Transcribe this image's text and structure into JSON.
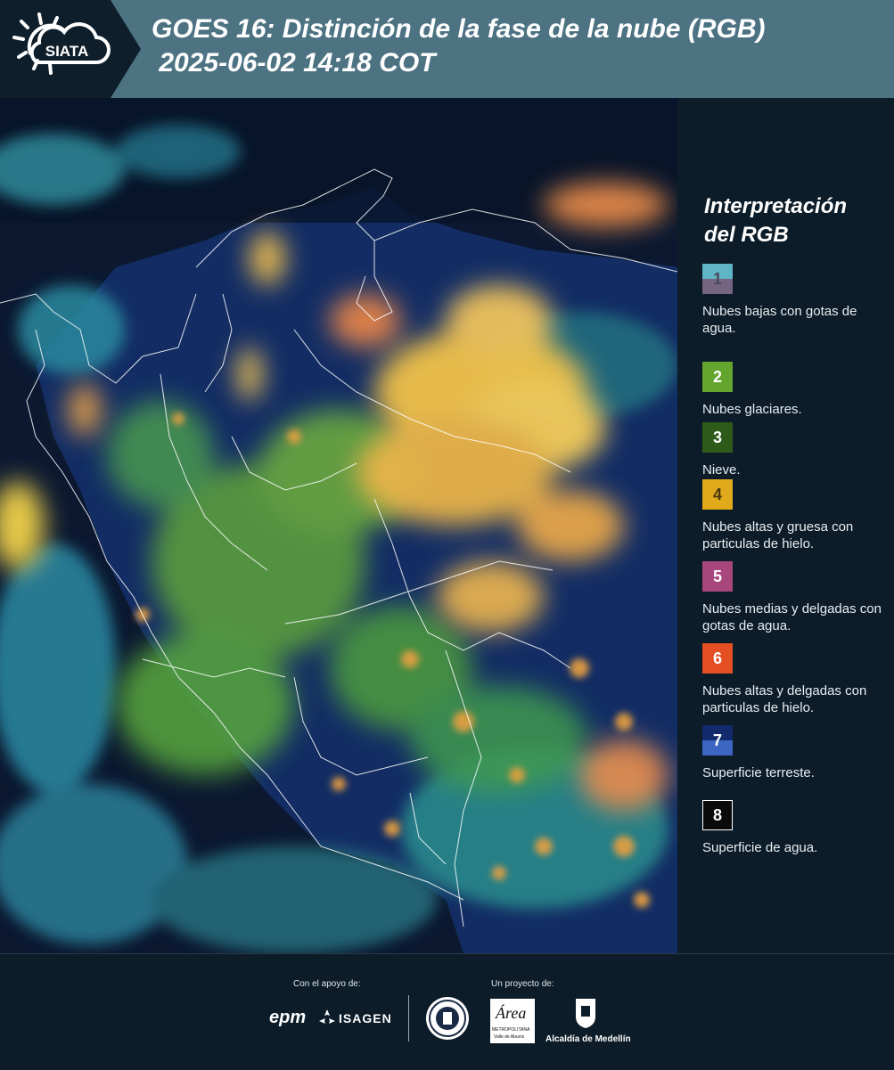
{
  "header": {
    "logo_text": "SIATA",
    "title_line1": "GOES 16: Distinción de la fase de la nube (RGB)",
    "title_line2": " 2025-06-02 14:18 COT"
  },
  "map": {
    "icon": "satellite-image"
  },
  "legend": {
    "title": "Interpretación del RGB",
    "items": [
      {
        "num": "1",
        "label": "Nubes bajas con gotas de agua.",
        "colors": [
          "#5fb4c6",
          "#756482"
        ],
        "text_color": "#4a4a5a"
      },
      {
        "num": "2",
        "label": "Nubes glaciares.",
        "colors": [
          "#64a52d"
        ],
        "text_color": "#ffffff"
      },
      {
        "num": "3",
        "label": "Nieve.",
        "colors": [
          "#2e5a1a"
        ],
        "text_color": "#ffffff"
      },
      {
        "num": "4",
        "label": "Nubes altas y gruesa con particulas de hielo.",
        "colors": [
          "#e1aa1b"
        ],
        "text_color": "#4a3a10"
      },
      {
        "num": "5",
        "label": "Nubes medias y delgadas con gotas de agua.",
        "colors": [
          "#a8467e"
        ],
        "text_color": "#ffffff"
      },
      {
        "num": "6",
        "label": "Nubes altas y delgadas con particulas de hielo.",
        "colors": [
          "#e54f24"
        ],
        "text_color": "#ffffff"
      },
      {
        "num": "7",
        "label": "Superficie terreste.",
        "colors": [
          "#132b6d",
          "#3d66c3"
        ],
        "text_color": "#ffffff"
      },
      {
        "num": "8",
        "label": "Superficie de agua.",
        "colors": [
          "#0a0a0a"
        ],
        "text_color": "#ffffff",
        "border": "#ffffff"
      }
    ]
  },
  "footer": {
    "support_label": "Con el apoyo de:",
    "project_label": "Un proyecto de:",
    "sponsor_epm": "epm",
    "sponsor_isagen": "ISAGEN",
    "area_logo_text": "Área",
    "area_subtext": "METROPOLITANA",
    "area_subtext2": "Valle de Aburrá",
    "alcaldia_text": "Alcaldía de Medellín"
  }
}
